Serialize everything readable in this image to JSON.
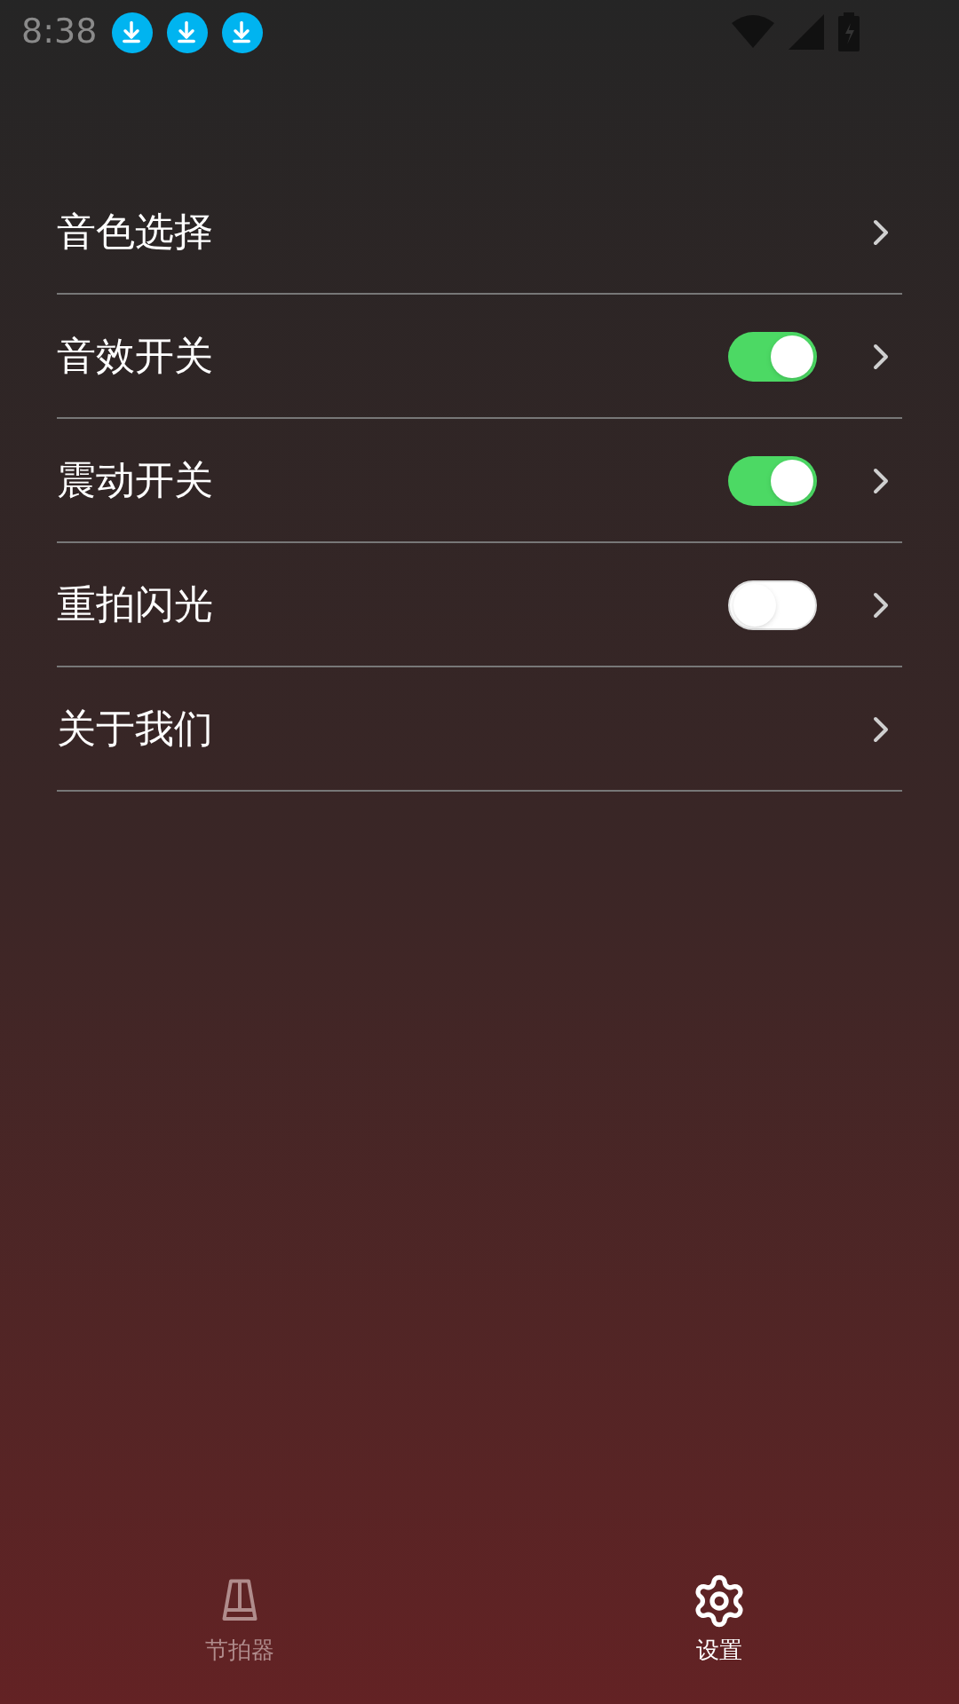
{
  "status_bar": {
    "time": "8:38"
  },
  "settings": [
    {
      "label": "音色选择",
      "kind": "link"
    },
    {
      "label": "音效开关",
      "kind": "toggle",
      "on": true
    },
    {
      "label": "震动开关",
      "kind": "toggle",
      "on": true
    },
    {
      "label": "重拍闪光",
      "kind": "toggle",
      "on": false
    },
    {
      "label": "关于我们",
      "kind": "link"
    }
  ],
  "tab_bar": [
    {
      "label": "节拍器",
      "selected": false
    },
    {
      "label": "设置",
      "selected": true
    }
  ]
}
